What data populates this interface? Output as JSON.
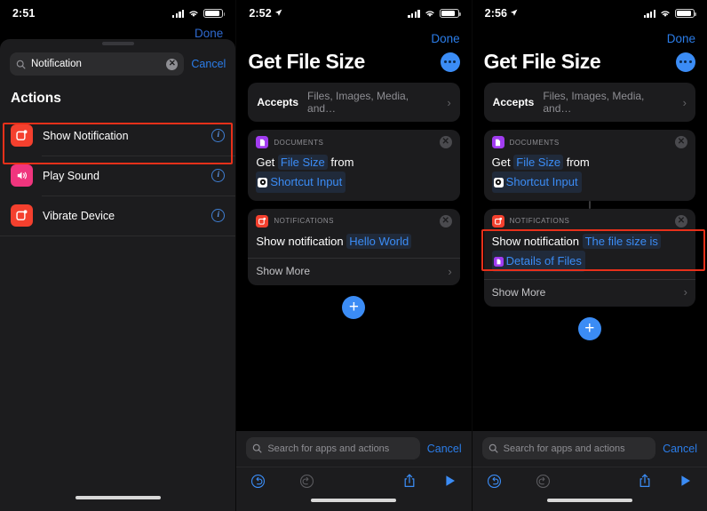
{
  "colors": {
    "accent_blue": "#3b8cf5",
    "link_blue": "#2b7de9",
    "highlight_red": "#e8301a",
    "notifications_red": "#f4402e",
    "documents_purple": "#a13cf0",
    "sound_pink": "#f0357e",
    "sheet_bg": "#1c1c1e",
    "page_bg": "#000000"
  },
  "panel_left": {
    "status": {
      "time": "2:51",
      "location_arrow": false,
      "signal": "cellular-bars-icon",
      "wifi": "wifi-icon",
      "battery": "battery-icon"
    },
    "done_label": "Done",
    "search": {
      "value": "Notification",
      "icon": "search-icon",
      "clear_icon": "clear-circle-icon",
      "cancel_label": "Cancel"
    },
    "section_title": "Actions",
    "actions": [
      {
        "label": "Show Notification",
        "icon": "notification-app-icon",
        "icon_color": "#f4402e",
        "info_icon": "info-circle-icon",
        "highlighted": true
      },
      {
        "label": "Play Sound",
        "icon": "speaker-wave-icon",
        "icon_color": "#f0357e",
        "info_icon": "info-circle-icon",
        "highlighted": false
      },
      {
        "label": "Vibrate Device",
        "icon": "notification-app-icon",
        "icon_color": "#f4402e",
        "info_icon": "info-circle-icon",
        "highlighted": false
      }
    ]
  },
  "panel_middle": {
    "status": {
      "time": "2:52",
      "location_arrow": true
    },
    "done_label": "Done",
    "title": "Get File Size",
    "more_button": "more-ellipsis-button",
    "accepts": {
      "label": "Accepts",
      "value": "Files, Images, Media, and…",
      "chevron": "chevron-right-icon"
    },
    "cards": [
      {
        "app": "DOCUMENTS",
        "app_icon": "documents-app-icon",
        "app_icon_color": "#a13cf0",
        "close_icon": "close-circle-icon",
        "line1_pre": "Get",
        "line1_token": "File Size",
        "line1_post": "from",
        "line2_var_icon": "shortcut-input-icon",
        "line2_token": "Shortcut Input",
        "has_show_more": false
      },
      {
        "app": "NOTIFICATIONS",
        "app_icon": "notification-app-icon",
        "app_icon_color": "#f4402e",
        "close_icon": "close-circle-icon",
        "line1_pre": "Show notification",
        "line1_token": "Hello World",
        "show_more_label": "Show More",
        "show_more_chevron": "chevron-right-icon",
        "has_show_more": true,
        "highlighted": false
      }
    ],
    "add_button": "add-action-button",
    "add_button_label": "+",
    "bottom_search": {
      "icon": "search-icon",
      "placeholder": "Search for apps and actions",
      "cancel_label": "Cancel"
    },
    "toolbar": {
      "undo": "undo-icon",
      "redo": "redo-icon",
      "share": "share-icon",
      "play": "play-icon"
    }
  },
  "panel_right": {
    "status": {
      "time": "2:56",
      "location_arrow": true
    },
    "done_label": "Done",
    "title": "Get File Size",
    "more_button": "more-ellipsis-button",
    "accepts": {
      "label": "Accepts",
      "value": "Files, Images, Media, and…",
      "chevron": "chevron-right-icon"
    },
    "cards": [
      {
        "app": "DOCUMENTS",
        "app_icon": "documents-app-icon",
        "app_icon_color": "#a13cf0",
        "close_icon": "close-circle-icon",
        "line1_pre": "Get",
        "line1_token": "File Size",
        "line1_post": "from",
        "line2_var_icon": "shortcut-input-icon",
        "line2_token": "Shortcut Input",
        "has_show_more": false
      },
      {
        "app": "NOTIFICATIONS",
        "app_icon": "notification-app-icon",
        "app_icon_color": "#f4402e",
        "close_icon": "close-circle-icon",
        "line1_pre": "Show notification",
        "line1_token": "The file size is",
        "line2_var_icon": "details-of-files-icon",
        "line2_token": "Details of Files",
        "show_more_label": "Show More",
        "show_more_chevron": "chevron-right-icon",
        "has_show_more": true,
        "highlighted": true
      }
    ],
    "add_button": "add-action-button",
    "add_button_label": "+",
    "bottom_search": {
      "icon": "search-icon",
      "placeholder": "Search for apps and actions",
      "cancel_label": "Cancel"
    },
    "toolbar": {
      "undo": "undo-icon",
      "redo": "redo-icon",
      "share": "share-icon",
      "play": "play-icon"
    }
  }
}
